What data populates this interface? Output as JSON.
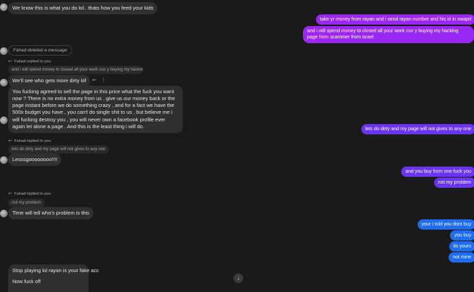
{
  "conversation": {
    "messages": {
      "m1": "We know this is what you do lol.. thats how you feed your kids",
      "m2": "take yr money from rayan and i send rayan number and his id in swapd",
      "m3": "and i will spend money to closed all your work coz y buying my hacking page from scammer from israel",
      "deleted": "Fahad deleted a message",
      "reply1_header": "Fahad replied to you",
      "reply1_quote": "and i will spend money to closed all your work coz y buying my hacking p...",
      "reply1_text": "We'll see who gets more dirty lol",
      "m4": "You fucking agreed to sell the page in this price what the fuck you want now ? There is no extra money from us , give us our money back or the page instant before we do something crazy , and for a fact we have the 500x budget you have , you can't do single shit to us , but believe me i will fucking destroy you , you will never own a facebook profile ever again let alone a page . And this is the least thing i will do.",
      "m5": "lets do dirty and my page will not gives to any one",
      "reply2_header": "Fahad replied to you",
      "reply2_quote": "lets do dirty and my page will not gives to any one",
      "reply2_text": "Lesssgoooooooo!!!!",
      "m6": "and you buy from one fuck you",
      "m7": "not my problem",
      "reply3_header": "Fahad replied to you",
      "reply3_quote": "not my problem",
      "reply3_text": "Time will tell who's problem is this",
      "m8": "your i told you dont buy",
      "m9": "you buy",
      "m10": "its yours",
      "m11": "not mine",
      "m12": "Stop playing lol rayan is your fake acc",
      "m13": "Now fuck off"
    }
  },
  "icons": {
    "reply": "reply-arrow-icon",
    "emoji": "emoji-icon",
    "more": "more-options-icon",
    "scroll": "scroll-down-icon"
  },
  "colors": {
    "background": "#1a1a1b",
    "incoming": "#303030",
    "outgoing_purple": "#9b27f2",
    "outgoing_violet": "#6a35f2",
    "outgoing_blue": "#1f6cf2"
  }
}
